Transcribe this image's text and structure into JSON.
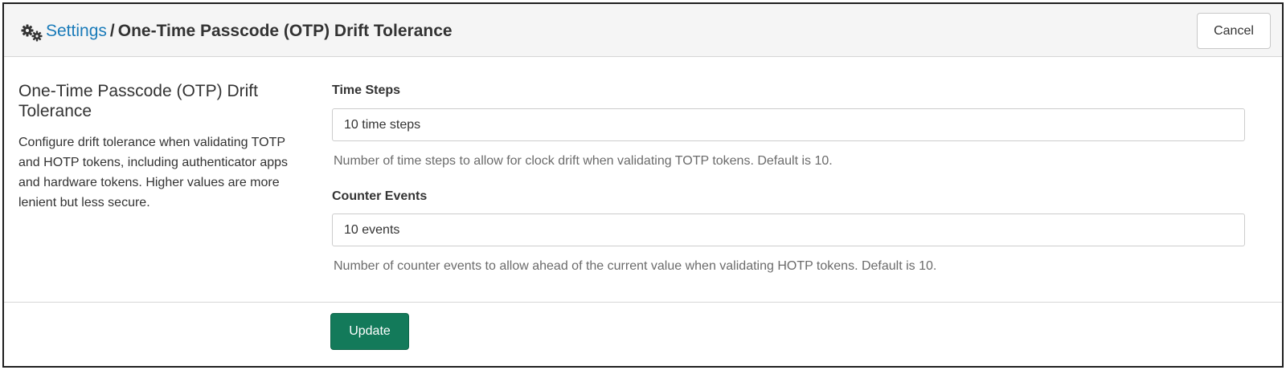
{
  "header": {
    "icon": "gears-icon",
    "breadcrumb_link": "Settings",
    "separator": "/",
    "title": "One-Time Passcode (OTP) Drift Tolerance",
    "cancel_label": "Cancel"
  },
  "sidebar": {
    "title": "One-Time Passcode (OTP) Drift Tolerance",
    "description": "Configure drift tolerance when validating TOTP and HOTP tokens, including authenticator apps and hardware tokens. Higher values are more lenient but less secure."
  },
  "fields": {
    "time_steps": {
      "label": "Time Steps",
      "value": "10 time steps",
      "help": "Number of time steps to allow for clock drift when validating TOTP tokens. Default is 10."
    },
    "counter_events": {
      "label": "Counter Events",
      "value": "10 events",
      "help": "Number of counter events to allow ahead of the current value when validating HOTP tokens. Default is 10."
    }
  },
  "footer": {
    "update_label": "Update"
  },
  "colors": {
    "link": "#1a7bb9",
    "primary_button": "#137a5a",
    "header_bg": "#f5f5f5"
  }
}
